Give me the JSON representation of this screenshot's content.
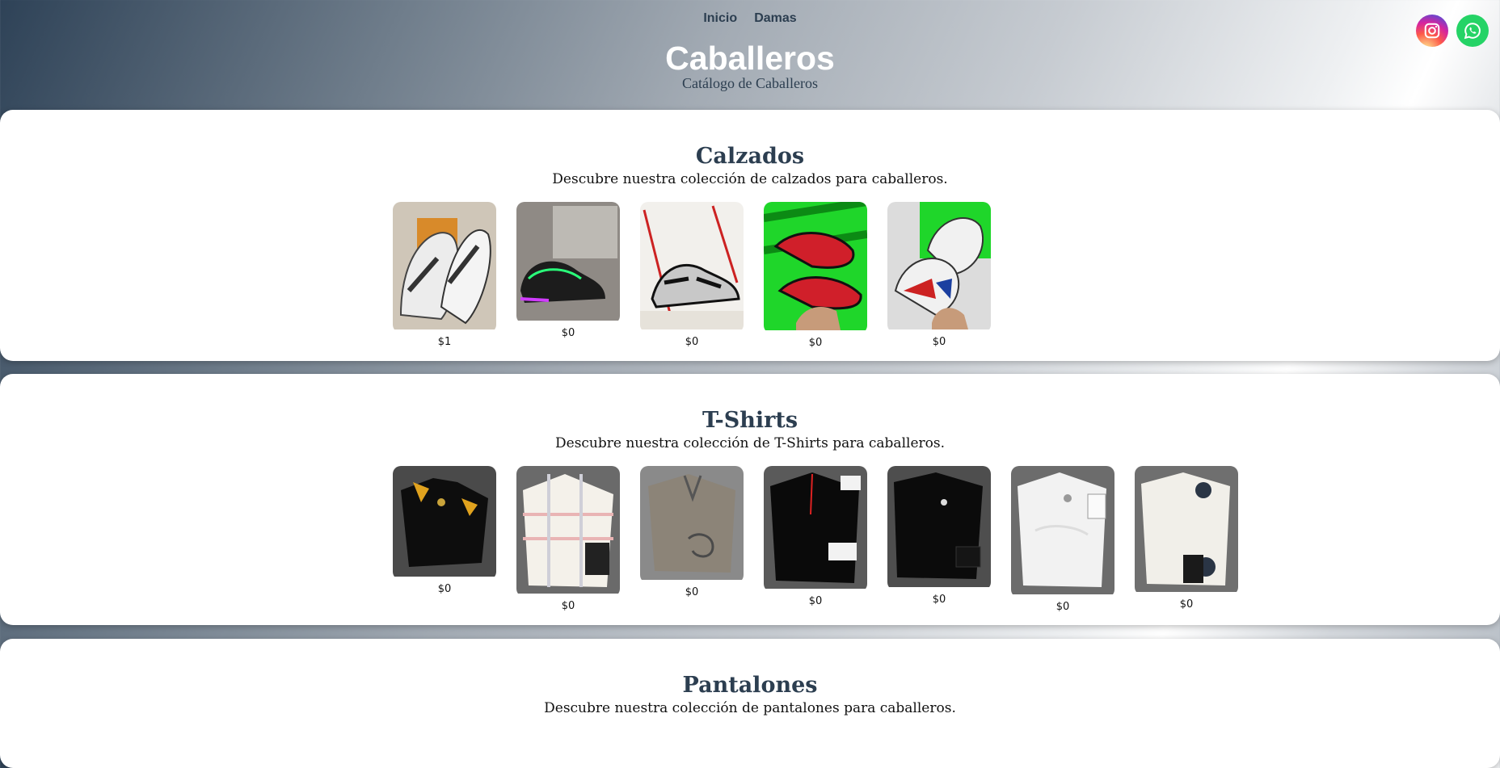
{
  "nav": {
    "items": [
      {
        "label": "Inicio"
      },
      {
        "label": "Damas"
      }
    ]
  },
  "social": [
    {
      "icon": "instagram-icon"
    },
    {
      "icon": "whatsapp-icon"
    }
  ],
  "header": {
    "title": "Caballeros",
    "subtitle": "Catálogo de Caballeros"
  },
  "sections": [
    {
      "title": "Calzados",
      "description": "Descubre nuestra colección de calzados para caballeros.",
      "products": [
        {
          "price": "$1"
        },
        {
          "price": "$0"
        },
        {
          "price": "$0"
        },
        {
          "price": "$0"
        },
        {
          "price": "$0"
        }
      ]
    },
    {
      "title": "T-Shirts",
      "description": "Descubre nuestra colección de T-Shirts para caballeros.",
      "products": [
        {
          "price": "$0"
        },
        {
          "price": "$0"
        },
        {
          "price": "$0"
        },
        {
          "price": "$0"
        },
        {
          "price": "$0"
        },
        {
          "price": "$0"
        },
        {
          "price": "$0"
        }
      ]
    },
    {
      "title": "Pantalones",
      "description": "Descubre nuestra colección de pantalones para caballeros.",
      "products": []
    }
  ]
}
